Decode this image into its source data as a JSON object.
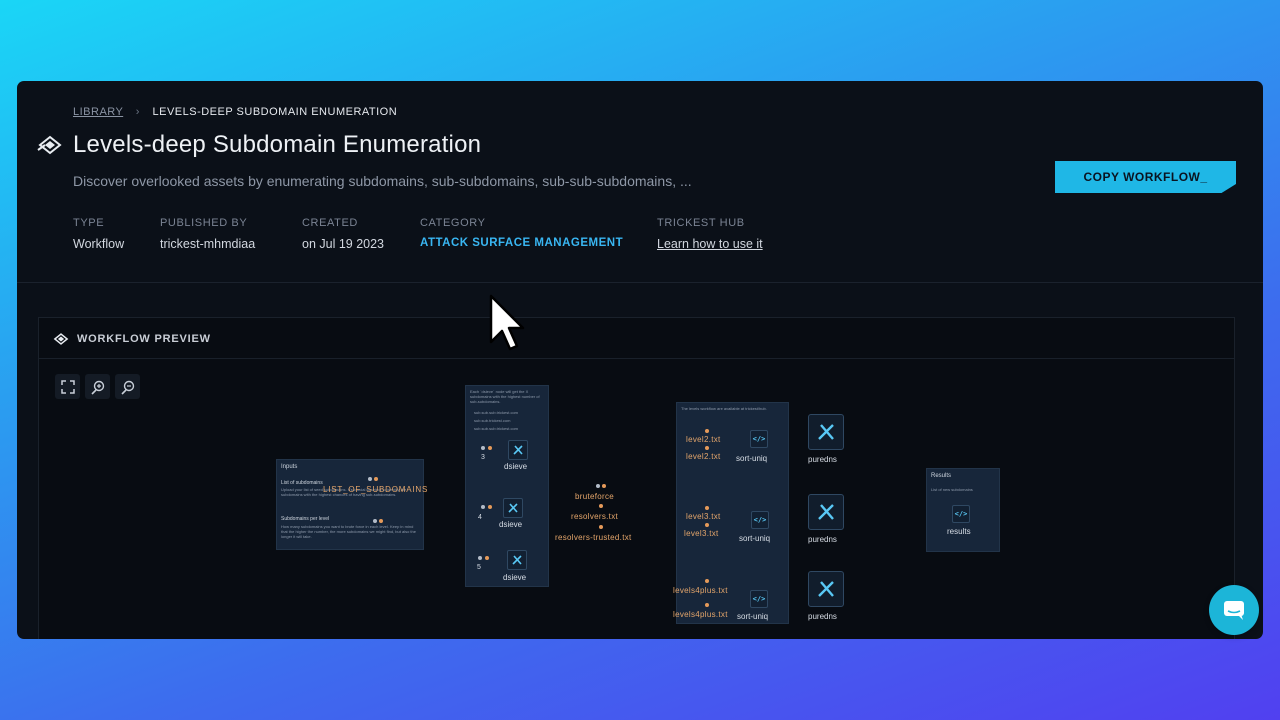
{
  "breadcrumb": {
    "library": "LIBRARY",
    "current": "LEVELS-DEEP SUBDOMAIN ENUMERATION"
  },
  "header": {
    "title": "Levels-deep Subdomain Enumeration",
    "description": "Discover overlooked assets by enumerating subdomains, sub-subdomains, sub-sub-subdomains, ...",
    "copy_button": "COPY WORKFLOW_"
  },
  "meta": {
    "type": {
      "label": "TYPE",
      "value": "Workflow"
    },
    "published_by": {
      "label": "PUBLISHED BY",
      "value": "trickest-mhmdiaa"
    },
    "created": {
      "label": "CREATED",
      "value": "on Jul 19 2023"
    },
    "category": {
      "label": "CATEGORY",
      "value": "ATTACK SURFACE MANAGEMENT"
    },
    "hub": {
      "label": "TRICKEST HUB",
      "value": "Learn how to use it"
    }
  },
  "preview": {
    "title": "WORKFLOW PREVIEW",
    "inputs_node": {
      "title": "Inputs",
      "subtitle1": "List of subdomains",
      "text1": "Upload your list of seed subdomains. It's crucial to select to identify the subdomains with the highest chances of having sub-subdomains.",
      "subtitle2": "Subdomains per level",
      "text2": "How many subdomains you want to brute force in each level. Keep in mind that the higher the number, the more subdomains we might find, but also the longer it will take.",
      "port": "LIST_OF_SUBDOMAINS"
    },
    "dsieve_node": {
      "text": "Each `dsieve` node will get the X subdomains with the highest number of sub-subdomains.",
      "bullets": [
        "sub.sub.sub.trickest.com",
        "sub.sub.trickest.com",
        "sub.sub.sub.trickest.com"
      ],
      "items": [
        {
          "num": "3",
          "label": "dsieve"
        },
        {
          "num": "4",
          "label": "dsieve"
        },
        {
          "num": "5",
          "label": "dsieve"
        }
      ]
    },
    "files": {
      "bruteforce": "bruteforce",
      "resolvers": "resolvers.txt",
      "resolvers_trusted": "resolvers-trusted.txt"
    },
    "levels_node": {
      "text": "The levels workflow are available at trickest/hub.",
      "rows": [
        {
          "a": "level2.txt",
          "b": "level2.txt",
          "tool": "sort-uniq",
          "out": "puredns"
        },
        {
          "a": "level3.txt",
          "b": "level3.txt",
          "tool": "sort-uniq",
          "out": "puredns"
        },
        {
          "a": "levels4plus.txt",
          "b": "levels4plus.txt",
          "tool": "sort-uniq",
          "out": "puredns"
        }
      ]
    },
    "results_node": {
      "title": "Results",
      "text": "List of new subdomains",
      "label": "results"
    }
  },
  "colors": {
    "accent": "#1fb7e6",
    "category": "#39b6f2",
    "port": "#e5a66b"
  }
}
